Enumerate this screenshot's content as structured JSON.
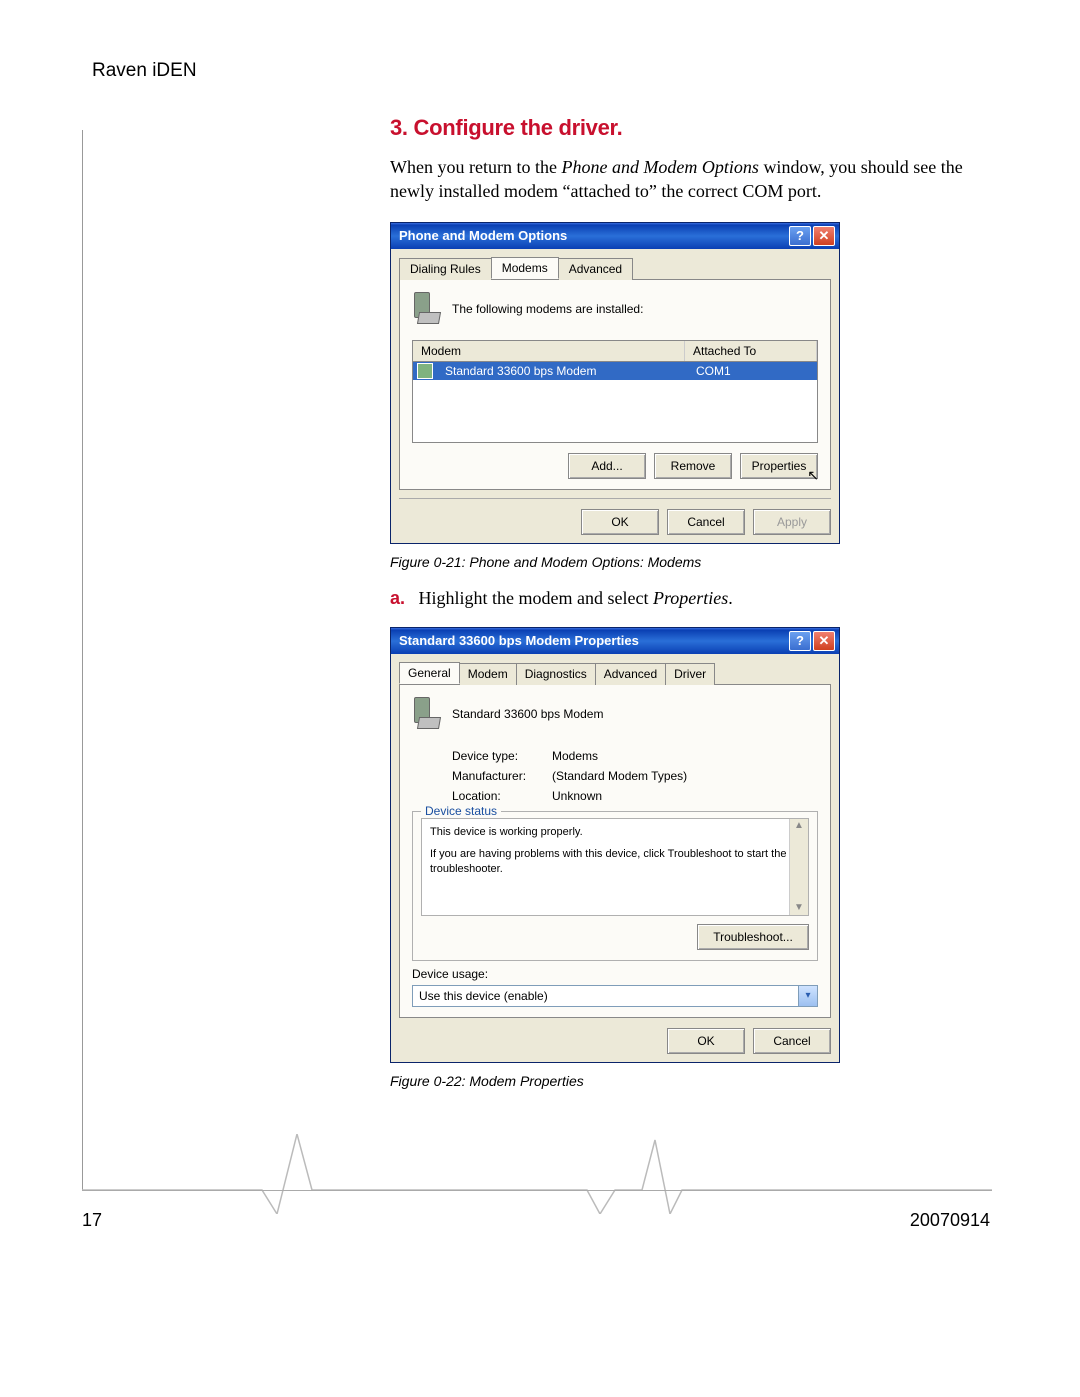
{
  "page": {
    "header": "Raven iDEN",
    "number": "17",
    "date": "20070914"
  },
  "section": {
    "title": "3. Configure the driver.",
    "intro_pre": "When you return to the ",
    "intro_em": "Phone and Modem Options",
    "intro_post": " window, you should see the newly installed modem “attached to” the correct COM port."
  },
  "fig1_caption": "Figure 0-21: Phone and Modem Options: Modems",
  "step_a": {
    "marker": "a.",
    "pre": "Highlight the modem and select ",
    "em": "Properties",
    "post": "."
  },
  "fig2_caption": "Figure 0-22: Modem Properties",
  "dlg1": {
    "title": "Phone and Modem Options",
    "tabs": {
      "t1": "Dialing Rules",
      "t2": "Modems",
      "t3": "Advanced"
    },
    "intro": "The following modems are installed:",
    "col_modem": "Modem",
    "col_attached": "Attached To",
    "row_name": "Standard 33600 bps Modem",
    "row_port": "COM1",
    "btn_add": "Add...",
    "btn_remove": "Remove",
    "btn_props": "Properties",
    "btn_ok": "OK",
    "btn_cancel": "Cancel",
    "btn_apply": "Apply"
  },
  "dlg2": {
    "title": "Standard 33600 bps Modem Properties",
    "tabs": {
      "t1": "General",
      "t2": "Modem",
      "t3": "Diagnostics",
      "t4": "Advanced",
      "t5": "Driver"
    },
    "name": "Standard 33600 bps Modem",
    "lbl_devtype": "Device type:",
    "val_devtype": "Modems",
    "lbl_manu": "Manufacturer:",
    "val_manu": "(Standard Modem Types)",
    "lbl_loc": "Location:",
    "val_loc": "Unknown",
    "gb_title": "Device status",
    "status_l1": "This device is working properly.",
    "status_l2": "If you are having problems with this device, click Troubleshoot to start the troubleshooter.",
    "btn_trouble": "Troubleshoot...",
    "lbl_usage": "Device usage:",
    "val_usage": "Use this device (enable)",
    "btn_ok": "OK",
    "btn_cancel": "Cancel"
  }
}
